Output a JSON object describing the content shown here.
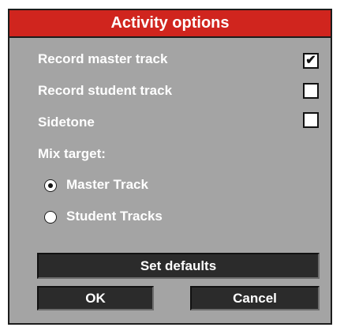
{
  "dialog": {
    "title": "Activity options",
    "options": [
      {
        "label": "Record master track",
        "checked": true
      },
      {
        "label": "Record student track",
        "checked": false
      },
      {
        "label": "Sidetone",
        "checked": false
      }
    ],
    "check_mark": "✔",
    "mix_target_label": "Mix target:",
    "mix_targets": [
      {
        "label": "Master Track",
        "selected": true
      },
      {
        "label": "Student Tracks",
        "selected": false
      }
    ],
    "buttons": {
      "set_defaults": "Set defaults",
      "ok": "OK",
      "cancel": "Cancel"
    }
  },
  "colors": {
    "title_bar": "#d0251e",
    "panel": "#a4a4a4",
    "button": "#2b2b2b"
  }
}
